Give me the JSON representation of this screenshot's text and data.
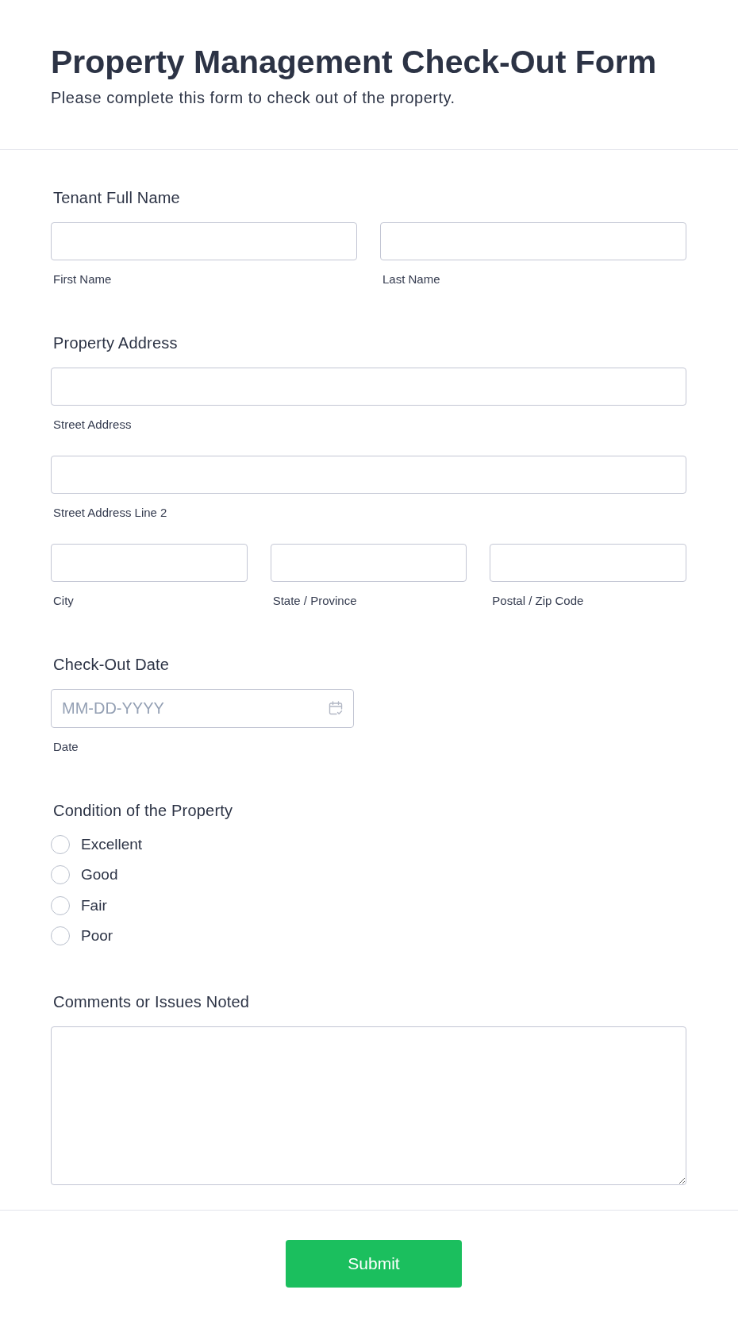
{
  "header": {
    "title": "Property Management Check-Out Form",
    "subtitle": "Please complete this form to check out of the property."
  },
  "sections": [
    {
      "kind": "inputs",
      "label": "Tenant Full Name",
      "rows": [
        {
          "inputs": [
            {
              "sublabel": "First Name"
            },
            {
              "sublabel": "Last Name"
            }
          ]
        }
      ]
    },
    {
      "kind": "inputs",
      "label": "Property Address",
      "rows": [
        {
          "inputs": [
            {
              "sublabel": "Street Address"
            }
          ]
        },
        {
          "inputs": [
            {
              "sublabel": "Street Address Line 2"
            }
          ]
        },
        {
          "inputs": [
            {
              "sublabel": "City"
            },
            {
              "sublabel": "State / Province"
            },
            {
              "sublabel": "Postal / Zip Code"
            }
          ]
        }
      ]
    },
    {
      "kind": "date",
      "label": "Check-Out Date",
      "placeholder": "MM-DD-YYYY",
      "sublabel": "Date"
    },
    {
      "kind": "radio",
      "label": "Condition of the Property",
      "options": [
        {
          "label": "Excellent",
          "selected": false
        },
        {
          "label": "Good",
          "selected": false
        },
        {
          "label": "Fair",
          "selected": false
        },
        {
          "label": "Poor",
          "selected": false
        }
      ]
    },
    {
      "kind": "textarea",
      "label": "Comments or Issues Noted"
    }
  ],
  "submit": {
    "label": "Submit"
  }
}
